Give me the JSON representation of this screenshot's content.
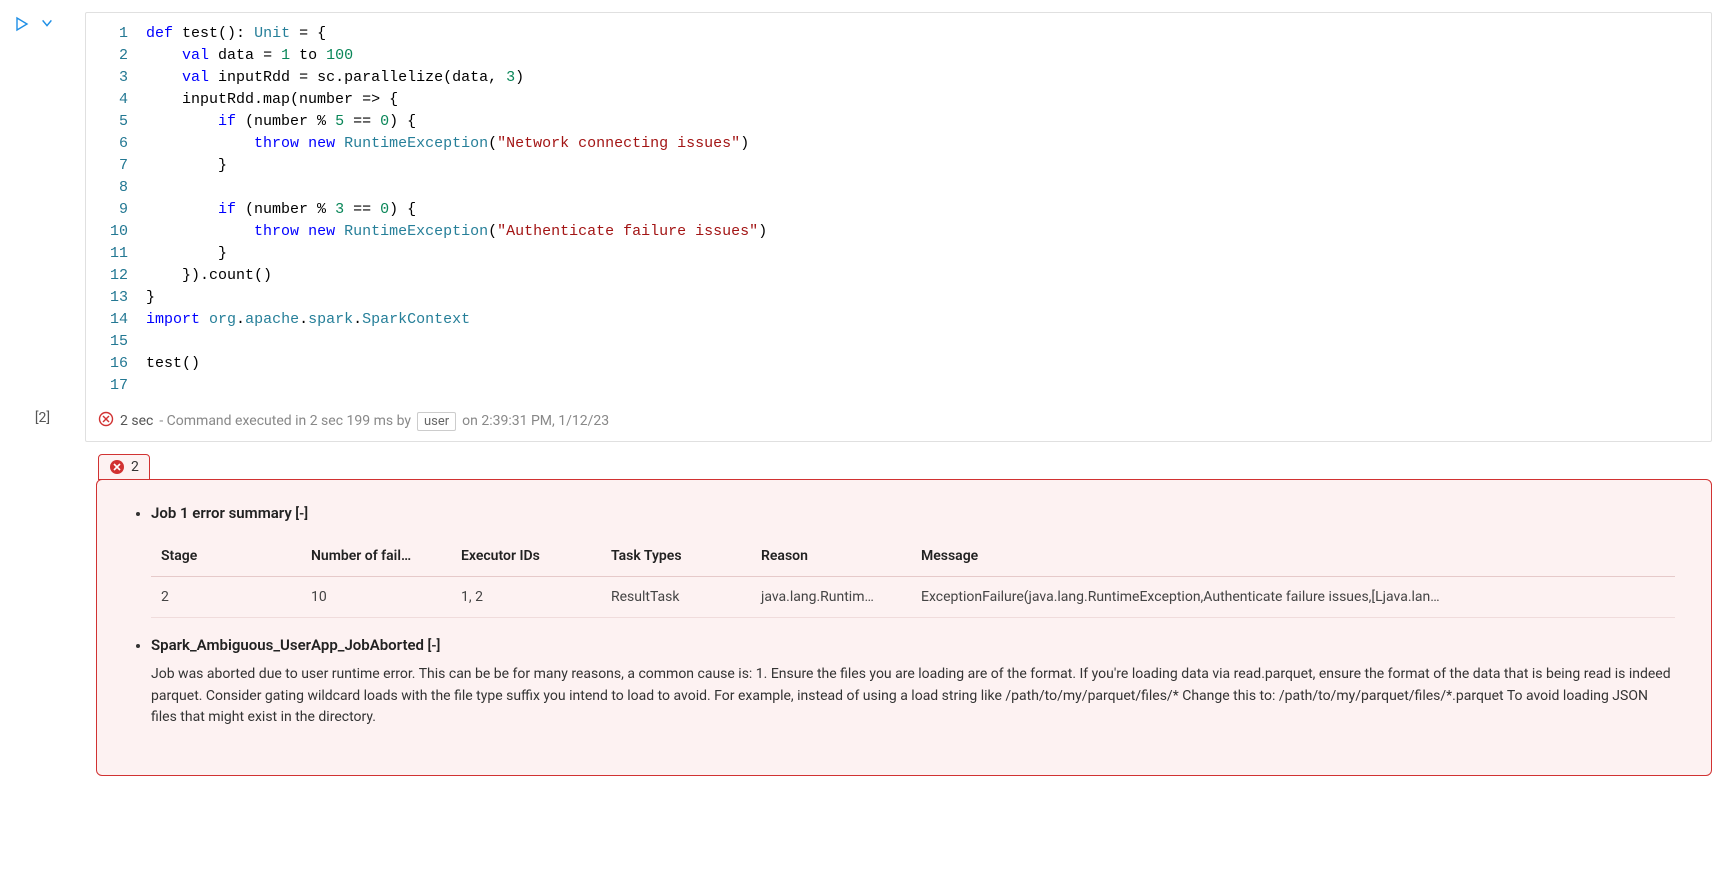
{
  "cell": {
    "index_label": "[2]",
    "gutter": [
      "1",
      "2",
      "3",
      "4",
      "5",
      "6",
      "7",
      "8",
      "9",
      "10",
      "11",
      "12",
      "13",
      "14",
      "15",
      "16",
      "17"
    ],
    "code_lines": [
      [
        [
          "kw",
          "def"
        ],
        [
          "sp",
          " "
        ],
        [
          "fn",
          "test"
        ],
        [
          "op",
          "(): "
        ],
        [
          "type",
          "Unit"
        ],
        [
          "op",
          " = {"
        ]
      ],
      [
        [
          "sp",
          "    "
        ],
        [
          "kw",
          "val"
        ],
        [
          "sp",
          " "
        ],
        [
          "id",
          "data"
        ],
        [
          "op",
          " = "
        ],
        [
          "num",
          "1"
        ],
        [
          "op",
          " to "
        ],
        [
          "num",
          "100"
        ]
      ],
      [
        [
          "sp",
          "    "
        ],
        [
          "kw",
          "val"
        ],
        [
          "sp",
          " "
        ],
        [
          "id",
          "inputRdd"
        ],
        [
          "op",
          " = sc.parallelize(data, "
        ],
        [
          "num",
          "3"
        ],
        [
          "op",
          ")"
        ]
      ],
      [
        [
          "sp",
          "    "
        ],
        [
          "id",
          "inputRdd"
        ],
        [
          "op",
          ".map("
        ],
        [
          "id",
          "number"
        ],
        [
          "op",
          " => {"
        ]
      ],
      [
        [
          "sp",
          "        "
        ],
        [
          "kw",
          "if"
        ],
        [
          "op",
          " (number % "
        ],
        [
          "num",
          "5"
        ],
        [
          "op",
          " == "
        ],
        [
          "num",
          "0"
        ],
        [
          "op",
          ") {"
        ]
      ],
      [
        [
          "sp",
          "            "
        ],
        [
          "kw",
          "throw"
        ],
        [
          "sp",
          " "
        ],
        [
          "kw",
          "new"
        ],
        [
          "sp",
          " "
        ],
        [
          "cls",
          "RuntimeException"
        ],
        [
          "op",
          "("
        ],
        [
          "str",
          "\"Network connecting issues\""
        ],
        [
          "op",
          ")"
        ]
      ],
      [
        [
          "sp",
          "        "
        ],
        [
          "op",
          "}"
        ]
      ],
      [
        [
          "sp",
          ""
        ]
      ],
      [
        [
          "sp",
          "        "
        ],
        [
          "kw",
          "if"
        ],
        [
          "op",
          " (number % "
        ],
        [
          "num",
          "3"
        ],
        [
          "op",
          " == "
        ],
        [
          "num",
          "0"
        ],
        [
          "op",
          ") {"
        ]
      ],
      [
        [
          "sp",
          "            "
        ],
        [
          "kw",
          "throw"
        ],
        [
          "sp",
          " "
        ],
        [
          "kw",
          "new"
        ],
        [
          "sp",
          " "
        ],
        [
          "cls",
          "RuntimeException"
        ],
        [
          "op",
          "("
        ],
        [
          "str",
          "\"Authenticate failure issues\""
        ],
        [
          "op",
          ")"
        ]
      ],
      [
        [
          "sp",
          "        "
        ],
        [
          "op",
          "}"
        ]
      ],
      [
        [
          "sp",
          "    "
        ],
        [
          "op",
          "}).count()"
        ]
      ],
      [
        [
          "op",
          "}"
        ]
      ],
      [
        [
          "kw",
          "import"
        ],
        [
          "sp",
          " "
        ],
        [
          "pkg",
          "org"
        ],
        [
          "op",
          "."
        ],
        [
          "pkg",
          "apache"
        ],
        [
          "op",
          "."
        ],
        [
          "pkg",
          "spark"
        ],
        [
          "op",
          "."
        ],
        [
          "cls",
          "SparkContext"
        ]
      ],
      [
        [
          "sp",
          ""
        ]
      ],
      [
        [
          "fn",
          "test"
        ],
        [
          "op",
          "()"
        ]
      ],
      [
        [
          "sp",
          ""
        ]
      ]
    ],
    "status": {
      "duration": "2 sec",
      "exec_text": " - Command executed in 2 sec 199 ms by",
      "user": "user",
      "on_text": "on 2:39:31 PM, 1/12/23"
    }
  },
  "error": {
    "tab_count": "2",
    "summaries": [
      {
        "title": "Job 1 error summary",
        "toggle": "[-]",
        "columns": [
          "Stage",
          "Number of fail…",
          "Executor IDs",
          "Task Types",
          "Reason",
          "Message"
        ],
        "rows": [
          {
            "stage": "2",
            "failures": "10",
            "executors": "1, 2",
            "task_types": "ResultTask",
            "reason": "java.lang.Runtim…",
            "message": "ExceptionFailure(java.lang.RuntimeException,Authenticate failure issues,[Ljava.lan…"
          }
        ]
      },
      {
        "title": "Spark_Ambiguous_UserApp_JobAborted",
        "toggle": "[-]",
        "body": "Job was aborted due to user runtime error. This can be be for many reasons, a common cause is: 1. Ensure the files you are loading are of the format. If you're loading data via read.parquet, ensure the format of the data that is being read is indeed parquet. Consider gating wildcard loads with the file type suffix you intend to load to avoid. For example, instead of using a load string like /path/to/my/parquet/files/* Change this to: /path/to/my/parquet/files/*.parquet To avoid loading JSON files that might exist in the directory."
      }
    ]
  }
}
